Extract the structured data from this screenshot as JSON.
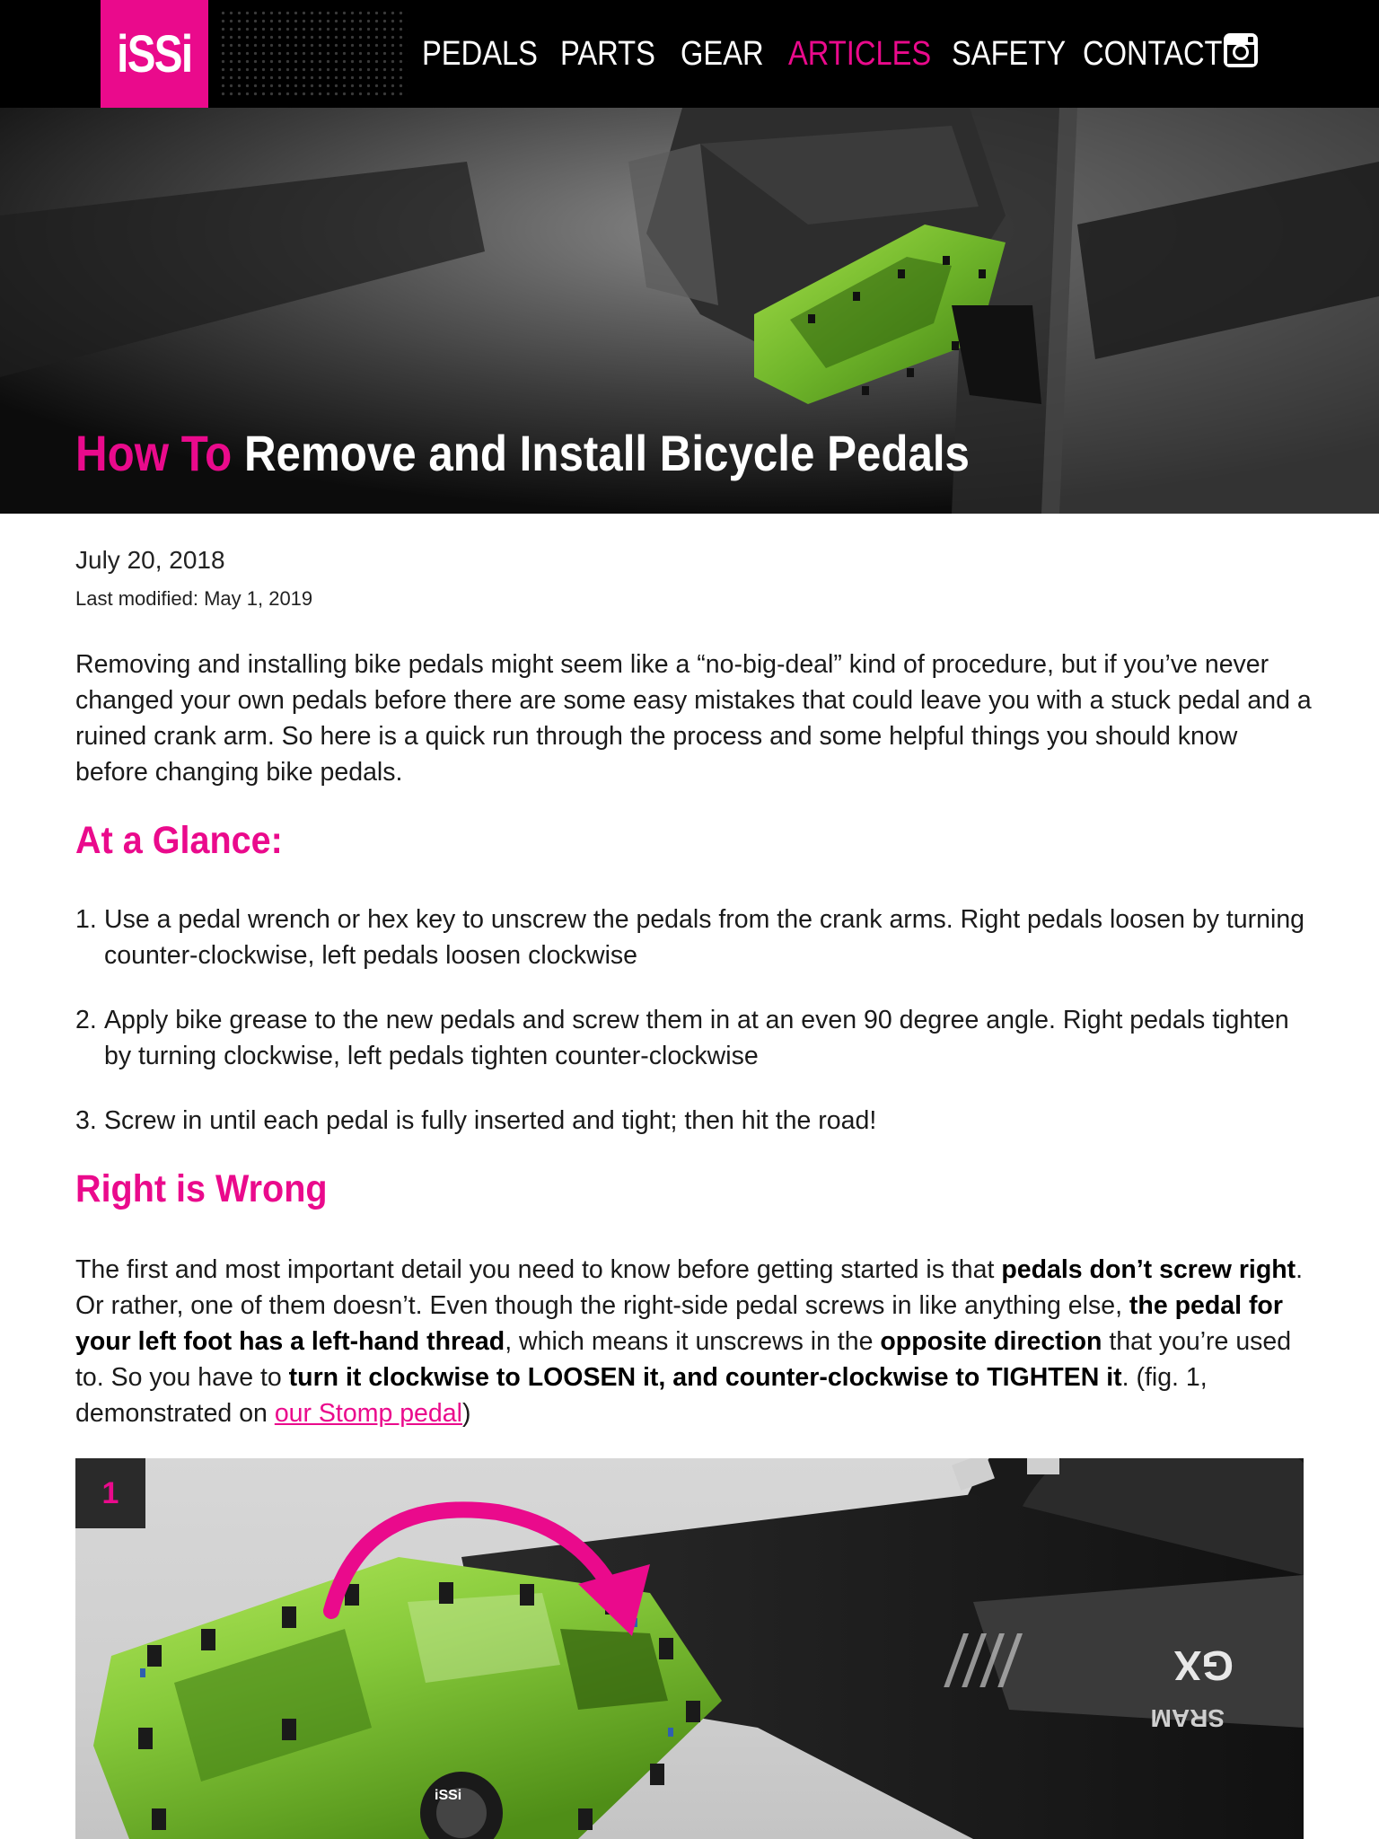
{
  "header": {
    "logo_text": "iSSi",
    "nav": [
      {
        "label": "PEDALS",
        "active": false
      },
      {
        "label": "PARTS",
        "active": false
      },
      {
        "label": "GEAR",
        "active": false
      },
      {
        "label": "ARTICLES",
        "active": true
      },
      {
        "label": "SAFETY",
        "active": false
      },
      {
        "label": "CONTACT",
        "active": false
      }
    ],
    "social_icon": "instagram-icon"
  },
  "hero": {
    "title_prefix": "How To",
    "title_main": "Remove and Install Bicycle Pedals"
  },
  "article": {
    "date": "July 20, 2018",
    "last_modified": "Last modified: May 1, 2019",
    "intro": "Removing and installing bike pedals might seem like a “no-big-deal” kind of procedure, but if you’ve never changed your own pedals before there are some easy mistakes that could leave you with a stuck pedal and a ruined crank arm. So here is a quick run through the process and some helpful things you should know before changing bike pedals.",
    "glance_heading": "At a Glance:",
    "steps": [
      {
        "num": "1.",
        "text": "Use a pedal wrench or hex key to unscrew the pedals from the crank arms. Right pedals loosen by turning counter-clockwise, left pedals loosen clockwise"
      },
      {
        "num": "2.",
        "text": "Apply bike grease to the new pedals and screw them in at an even 90 degree angle. Right pedals tighten by turning clockwise, left pedals tighten counter-clockwise"
      },
      {
        "num": "3.",
        "text": "Screw in until each pedal is fully inserted and tight; then hit the road!"
      }
    ],
    "right_heading": "Right is Wrong",
    "para": {
      "t1": "The first and most important detail you need to know before getting started is that ",
      "b1": "pedals don’t screw right",
      "t2": ". Or rather, one of them doesn’t. Even though the right-side pedal screws in like anything else, ",
      "b2": "the pedal for your left foot has a left-hand thread",
      "t3": ", which means it unscrews in the ",
      "b3": "opposite direction",
      "t4": " that you’re used to. So you have to ",
      "b4": "turn it clockwise to LOOSEN it, and counter-clockwise to TIGHTEN it",
      "t5": ". (fig. 1, demonstrated on ",
      "link": "our Stomp pedal",
      "t6": ")"
    },
    "figure": {
      "badge": "1",
      "crank_label": "GX",
      "brand_label": "SRAM",
      "pedal_label": "iSSi"
    }
  },
  "colors": {
    "accent": "#ea0a8c",
    "pedal_green": "#8cc63f",
    "header_bg": "#000000"
  }
}
